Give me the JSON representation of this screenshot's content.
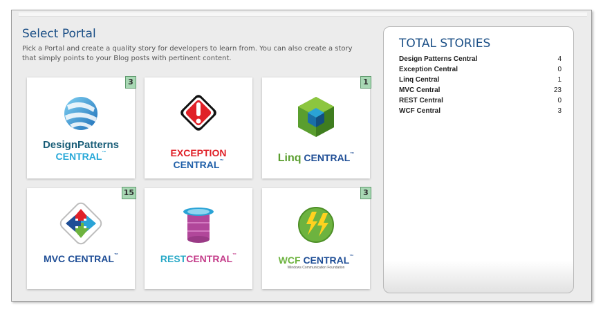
{
  "header": {
    "title": "Select Portal",
    "subtitle": "Pick a Portal and create a quality story for developers to learn from. You can also create a story that simply points to your Blog posts with pertinent content."
  },
  "portals": [
    {
      "name_part1": "DesignPatterns",
      "name_part2": "CENTRAL",
      "tm": "™",
      "count": "3",
      "icon": "globe-icon"
    },
    {
      "name_part1": "EXCEPTION",
      "name_part2": "CENTRAL",
      "tm": "™",
      "count": "",
      "icon": "warning-icon"
    },
    {
      "name_part1": "Linq",
      "name_part2": "CENTRAL",
      "tm": "™",
      "count": "1",
      "icon": "cube-icon"
    },
    {
      "name_part1": "MVC",
      "name_part2": "CENTRAL",
      "tm": "™",
      "count": "15",
      "icon": "arrows-icon"
    },
    {
      "name_part1": "REST",
      "name_part2": "CENTRAL",
      "tm": "™",
      "count": "",
      "icon": "database-icon"
    },
    {
      "name_part1": "WCF",
      "name_part2": "CENTRAL",
      "tm": "™",
      "count": "3",
      "sub": "Windows Communication Foundation",
      "icon": "lightning-icon"
    }
  ],
  "totals": {
    "title": "TOTAL STORIES",
    "rows": [
      {
        "name": "Design Patterns Central",
        "value": "4"
      },
      {
        "name": "Exception Central",
        "value": "0"
      },
      {
        "name": "Linq Central",
        "value": "1"
      },
      {
        "name": "MVC Central",
        "value": "23"
      },
      {
        "name": "REST Central",
        "value": "0"
      },
      {
        "name": "WCF Central",
        "value": "3"
      }
    ]
  },
  "colors": {
    "title_blue": "#1b4f86",
    "badge_green": "#a8d8b4",
    "exception_red": "#e02128",
    "linq_green": "#5a9e2e",
    "mvc_blue": "#1f4e96",
    "rest_pink": "#c43c8a",
    "wcf_green": "#6db33f",
    "central_cyan": "#27a8d8"
  }
}
